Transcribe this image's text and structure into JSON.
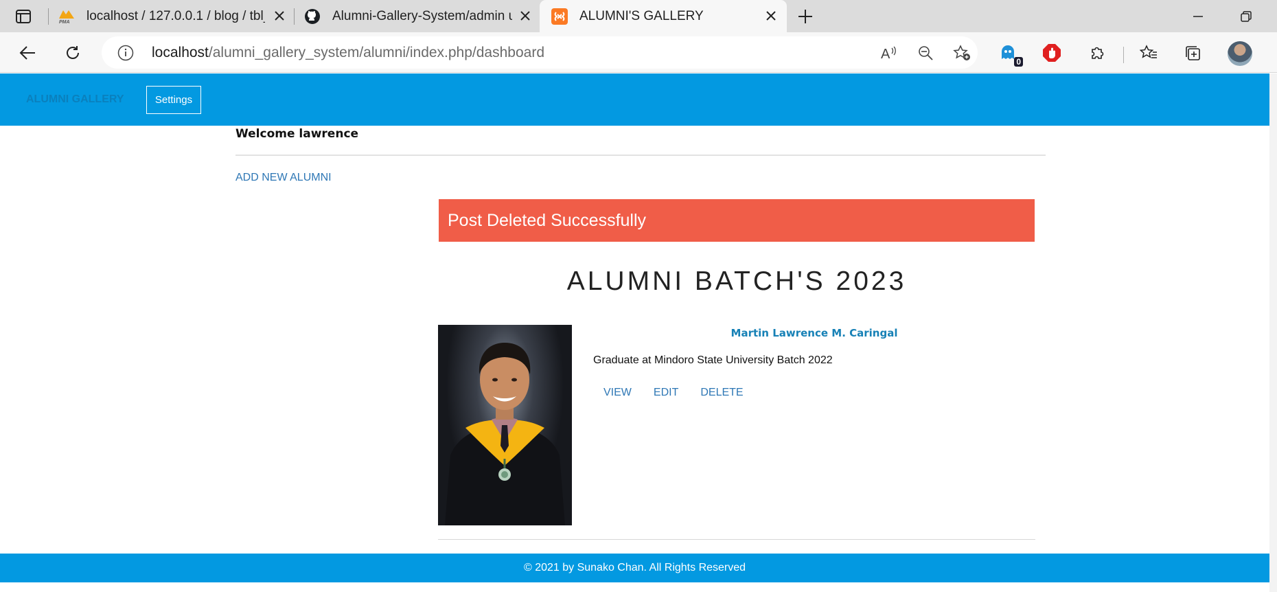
{
  "browser": {
    "tabs": [
      {
        "title": "localhost / 127.0.0.1 / blog / tbl_u",
        "icon": "phpmyadmin-icon"
      },
      {
        "title": "Alumni-Gallery-System/admin us",
        "icon": "github-icon"
      },
      {
        "title": "ALUMNI'S GALLERY",
        "icon": "xampp-icon",
        "active": true
      }
    ],
    "address": {
      "host": "localhost",
      "path": "/alumni_gallery_system/alumni/index.php/dashboard"
    },
    "extension_badge": "0"
  },
  "navbar": {
    "brand": "ALUMNI GALLERY",
    "settings_label": "Settings",
    "color": "#0399e1"
  },
  "main": {
    "welcome": "Welcome lawrence",
    "add_link": "ADD NEW ALUMNI",
    "alert": "Post Deleted Successfully",
    "batch_title": "ALUMNI BATCH'S 2023",
    "alumni": [
      {
        "name": "Martin Lawrence M. Caringal",
        "description": "Graduate at Mindoro State University Batch 2022",
        "actions": {
          "view": "VIEW",
          "edit": "EDIT",
          "delete": "DELETE"
        }
      }
    ]
  },
  "footer": {
    "text": "© 2021 by Sunako Chan. All Rights Reserved"
  },
  "colors": {
    "accent": "#0399e1",
    "alert": "#f05d48",
    "link": "#2e77b5"
  }
}
